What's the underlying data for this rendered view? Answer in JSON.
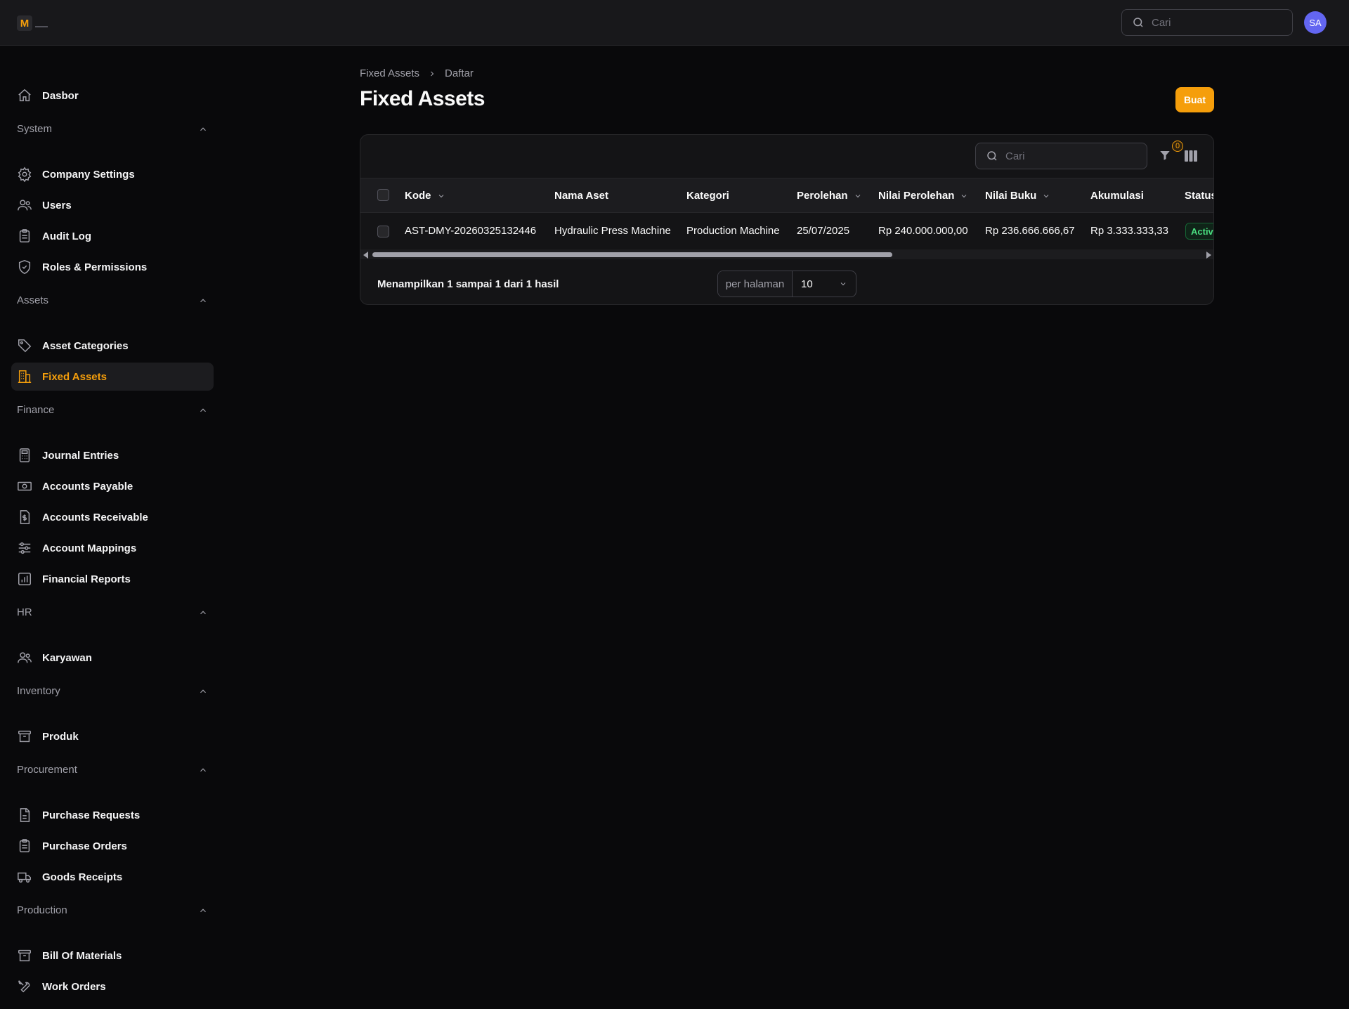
{
  "app": {
    "logo_letter": "M"
  },
  "topbar": {
    "search_placeholder": "Cari",
    "avatar_initials": "SA"
  },
  "sidebar": {
    "dashboard": "Dasbor",
    "groups": [
      {
        "label": "System",
        "items": [
          "Company Settings",
          "Users",
          "Audit Log",
          "Roles & Permissions"
        ]
      },
      {
        "label": "Assets",
        "items": [
          "Asset Categories",
          "Fixed Assets"
        ]
      },
      {
        "label": "Finance",
        "items": [
          "Journal Entries",
          "Accounts Payable",
          "Accounts Receivable",
          "Account Mappings",
          "Financial Reports"
        ]
      },
      {
        "label": "HR",
        "items": [
          "Karyawan"
        ]
      },
      {
        "label": "Inventory",
        "items": [
          "Produk"
        ]
      },
      {
        "label": "Procurement",
        "items": [
          "Purchase Requests",
          "Purchase Orders",
          "Goods Receipts"
        ]
      },
      {
        "label": "Production",
        "items": [
          "Bill Of Materials",
          "Work Orders"
        ]
      }
    ],
    "active": "Fixed Assets"
  },
  "breadcrumb": [
    "Fixed Assets",
    "Daftar"
  ],
  "page": {
    "title": "Fixed Assets",
    "create_label": "Buat"
  },
  "table": {
    "search_placeholder": "Cari",
    "filter_count": "0",
    "columns": [
      "Kode",
      "Nama Aset",
      "Kategori",
      "Perolehan",
      "Nilai Perolehan",
      "Nilai Buku",
      "Akumulasi",
      "Status"
    ],
    "rows": [
      {
        "kode": "AST-DMY-20260325132446",
        "nama": "Hydraulic Press Machine",
        "kategori": "Production Machine",
        "perolehan": "25/07/2025",
        "nilai_perolehan": "Rp 240.000.000,00",
        "nilai_buku": "Rp 236.666.666,67",
        "akumulasi": "Rp 3.333.333,33",
        "status": "Active"
      }
    ],
    "results_text": "Menampilkan 1 sampai 1 dari 1 hasil",
    "per_page_label": "per halaman",
    "per_page_value": "10"
  },
  "colors": {
    "accent": "#f59e0b",
    "background": "#09090b",
    "status_active": "#4ade80"
  }
}
